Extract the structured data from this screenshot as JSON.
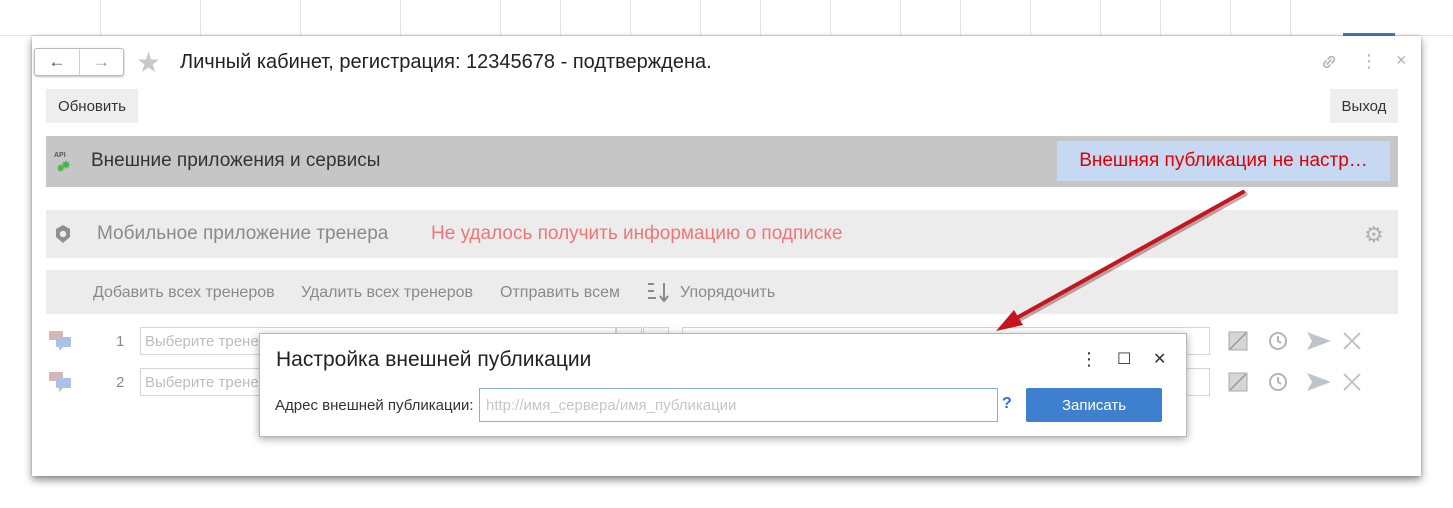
{
  "window": {
    "title": "Личный кабинет, регистрация: 12345678 - подтверждена.",
    "nav_back": "←",
    "nav_forward": "→",
    "star": "★",
    "link_icon": "🔗",
    "more_icon": "⋮",
    "close_icon": "×"
  },
  "toolbar": {
    "refresh_label": "Обновить",
    "exit_label": "Выход"
  },
  "external_services": {
    "api_text": "API",
    "label": "Внешние приложения и сервисы",
    "warning": "Внешняя публикация не настр…"
  },
  "mobile_app": {
    "label": "Мобильное приложение тренера",
    "error": "Не удалось получить информацию о подписке",
    "gear_icon": "⚙"
  },
  "actions": {
    "add_all": "Добавить всех тренеров",
    "remove_all": "Удалить всех тренеров",
    "send_all": "Отправить всем",
    "sort": "Упорядочить"
  },
  "rows": [
    {
      "num": "1",
      "trainer_placeholder": "Выберите тренера"
    },
    {
      "num": "2",
      "trainer_placeholder": "Выберите тренера"
    }
  ],
  "dialog": {
    "title": "Настройка внешней публикации",
    "more_icon": "⋮",
    "maximize_icon": "☐",
    "close_icon": "✕",
    "field_label": "Адрес внешней публикации:",
    "field_placeholder": "http://имя_сервера/имя_публикации",
    "field_value": "",
    "help": "?",
    "submit_label": "Записать"
  },
  "colors": {
    "warning_bg": "#c7d8f2",
    "warning_text": "#e00000",
    "error_text": "#f07676",
    "submit_bg": "#3f7fcf",
    "annotation_arrow": "#c8141e"
  }
}
